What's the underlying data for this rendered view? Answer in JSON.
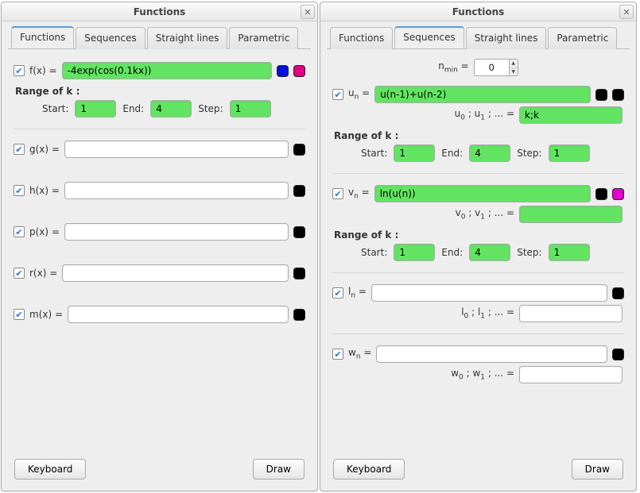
{
  "windows": [
    {
      "title": "Functions",
      "tabs": [
        "Functions",
        "Sequences",
        "Straight lines",
        "Parametric"
      ],
      "active_tab": 0,
      "footer": {
        "keyboard": "Keyboard",
        "draw": "Draw"
      },
      "functions": [
        {
          "checked": true,
          "name_html": "f(x) =",
          "value": "-4exp(cos(0.1kx))",
          "lime": true,
          "colors": [
            "blue",
            "pink"
          ],
          "range": {
            "title": "Range of k :",
            "start_lbl": "Start:",
            "start": "1",
            "end_lbl": "End:",
            "end": "4",
            "step_lbl": "Step:",
            "step": "1",
            "lime": true
          }
        },
        {
          "checked": true,
          "name_html": "g(x) =",
          "value": "",
          "lime": false,
          "colors": [
            "black"
          ]
        },
        {
          "checked": true,
          "name_html": "h(x) =",
          "value": "",
          "lime": false,
          "colors": [
            "black"
          ]
        },
        {
          "checked": true,
          "name_html": "p(x) =",
          "value": "",
          "lime": false,
          "colors": [
            "black"
          ]
        },
        {
          "checked": true,
          "name_html": "r(x) =",
          "value": "",
          "lime": false,
          "colors": [
            "black"
          ]
        },
        {
          "checked": true,
          "name_html": "m(x) =",
          "value": "",
          "lime": false,
          "colors": [
            "black"
          ]
        }
      ]
    },
    {
      "title": "Functions",
      "tabs": [
        "Functions",
        "Sequences",
        "Straight lines",
        "Parametric"
      ],
      "active_tab": 1,
      "footer": {
        "keyboard": "Keyboard",
        "draw": "Draw"
      },
      "nmin": {
        "label_pre": "n",
        "label_sub": "min",
        "label_post": " =",
        "value": "0"
      },
      "sequences": [
        {
          "checked": true,
          "name": "u",
          "sub": "n",
          "eq": " =",
          "value": "u(n-1)+u(n-2)",
          "lime": true,
          "colors": [
            "black",
            "black"
          ],
          "init_label_pre": "u",
          "init_sub0": "0",
          "init_sub1": "1",
          "init_label_post": " ; ... =",
          "init_value": "k;k",
          "init_lime": true,
          "range": {
            "title": "Range of k :",
            "start_lbl": "Start:",
            "start": "1",
            "end_lbl": "End:",
            "end": "4",
            "step_lbl": "Step:",
            "step": "1",
            "lime": true
          }
        },
        {
          "checked": true,
          "name": "v",
          "sub": "n",
          "eq": " =",
          "value": "ln(u(n))",
          "lime": true,
          "colors": [
            "black",
            "magenta"
          ],
          "init_label_pre": "v",
          "init_sub0": "0",
          "init_sub1": "1",
          "init_label_post": " ; ... =",
          "init_value": "",
          "init_lime": true,
          "range": {
            "title": "Range of k :",
            "start_lbl": "Start:",
            "start": "1",
            "end_lbl": "End:",
            "end": "4",
            "step_lbl": "Step:",
            "step": "1",
            "lime": true
          }
        },
        {
          "checked": true,
          "name": "l",
          "sub": "n",
          "eq": " =",
          "value": "",
          "lime": false,
          "colors": [
            "black"
          ],
          "init_label_pre": "l",
          "init_sub0": "0",
          "init_sub1": "1",
          "init_label_post": " ; ... =",
          "init_value": "",
          "init_lime": false
        },
        {
          "checked": true,
          "name": "w",
          "sub": "n",
          "eq": " =",
          "value": "",
          "lime": false,
          "colors": [
            "black"
          ],
          "init_label_pre": "w",
          "init_sub0": "0",
          "init_sub1": "1",
          "init_label_post": " ; ... =",
          "init_value": "",
          "init_lime": false
        }
      ]
    }
  ]
}
